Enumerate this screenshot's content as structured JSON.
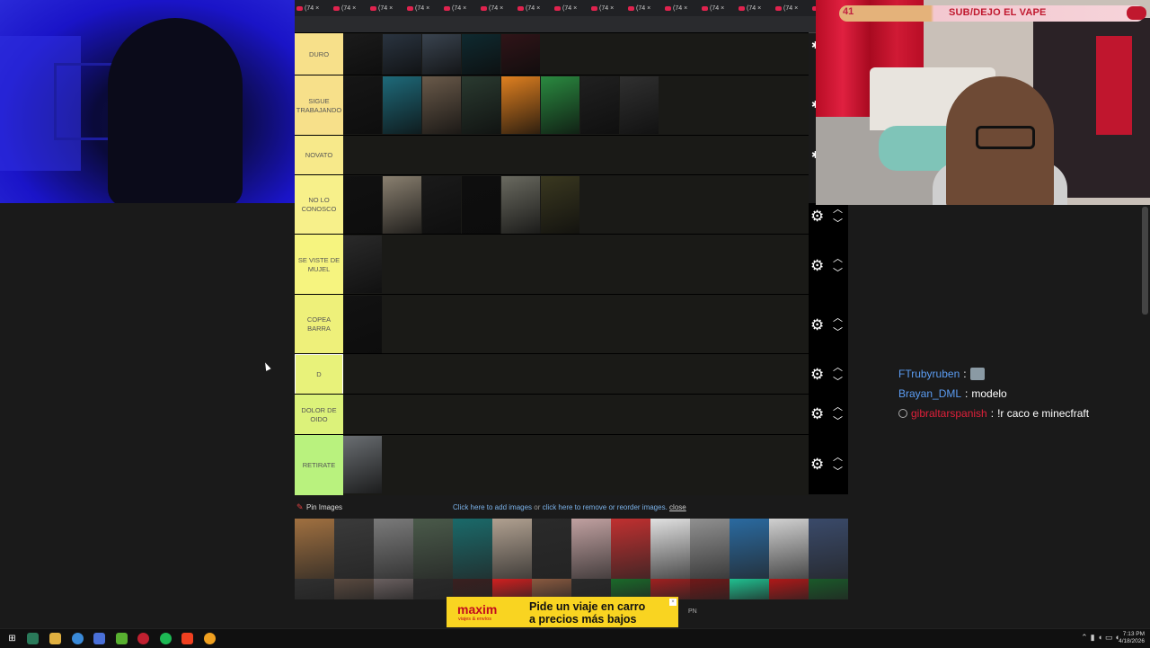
{
  "overlay": {
    "count": "41",
    "goal_text": "SUB/DEJO EL VAPE"
  },
  "browser": {
    "tab_label": "(74",
    "tab_close": "×",
    "tab_count": 15
  },
  "tiers": [
    {
      "label": "DURO",
      "color": "#f7e08a",
      "item_colors": [
        "#1b1b1b",
        "#2a3440",
        "#3a4450",
        "#0f2a30",
        "#301418"
      ]
    },
    {
      "label": "SIGUE TRABAJANDO",
      "color": "#f7e08a",
      "item_colors": [
        "#161616",
        "#1e6a7a",
        "#6a5a4a",
        "#2a3a30",
        "#e08020",
        "#2a8a40",
        "#202020",
        "#303030"
      ]
    },
    {
      "label": "NOVATO",
      "color": "#f7e98a",
      "item_colors": []
    },
    {
      "label": "NO LO CONOSCO",
      "color": "#f7f08a",
      "item_colors": [
        "#111111",
        "#8a8070",
        "#1a1a1a",
        "#0e0e0e",
        "#6a6a60",
        "#3a3820"
      ]
    },
    {
      "label": "SE VISTE DE MUJEL",
      "color": "#f6f47f",
      "item_colors": [
        "#2a2a2a"
      ]
    },
    {
      "label": "COPEA BARRA",
      "color": "#eef07a",
      "item_colors": [
        "#121212"
      ]
    },
    {
      "label": "D",
      "color": "#e8f27a",
      "item_colors": []
    },
    {
      "label": "DOLOR DE OIDO",
      "color": "#dcf27a",
      "item_colors": []
    },
    {
      "label": "RETIRATE",
      "color": "#b9f27e",
      "item_colors": [
        "#6a6e72"
      ]
    }
  ],
  "pin": {
    "label": "Pin Images",
    "link_add": "Click here to add images",
    "or": "or",
    "link_remove": "click here to remove or reorder images.",
    "close": "close"
  },
  "pool_colors": [
    "#a07040",
    "#3a3a3a",
    "#7a7a7a",
    "#4a5a4a",
    "#1a6a6a",
    "#b0a090",
    "#2a2a2a",
    "#c0a0a0",
    "#c03030",
    "#e0e0e0",
    "#909090",
    "#2a6aa0",
    "#d0d0d0",
    "#3a4a6a"
  ],
  "pool_colors_row2": [
    "#303030",
    "#5a4a40",
    "#6a6060",
    "#2a2a2a",
    "#3a2020",
    "#d02020",
    "#8a5a40",
    "#2a2a2a",
    "#1a6a2a",
    "#a02020",
    "#701818",
    "#20c090",
    "#b01818",
    "#1a5a2a"
  ],
  "chat": [
    {
      "user": "FTrubyruben",
      "color": "#5b9cf2",
      "msg": "",
      "emote": true,
      "badge": false
    },
    {
      "user": "Brayan_DML",
      "color": "#5b9cf2",
      "msg": "modelo",
      "emote": false,
      "badge": false
    },
    {
      "user": "gibraltarspanish",
      "color": "#e0203a",
      "msg": "!r caco e minecfraft",
      "emote": false,
      "badge": true
    }
  ],
  "ad": {
    "logo": "maxim",
    "sub": "viajes & envíos",
    "line1": "Pide un viaje en carro",
    "line2": "a precios más bajos",
    "pn": "PN"
  },
  "taskbar": {
    "time": "7:13 PM",
    "date": "4/18/2026"
  }
}
